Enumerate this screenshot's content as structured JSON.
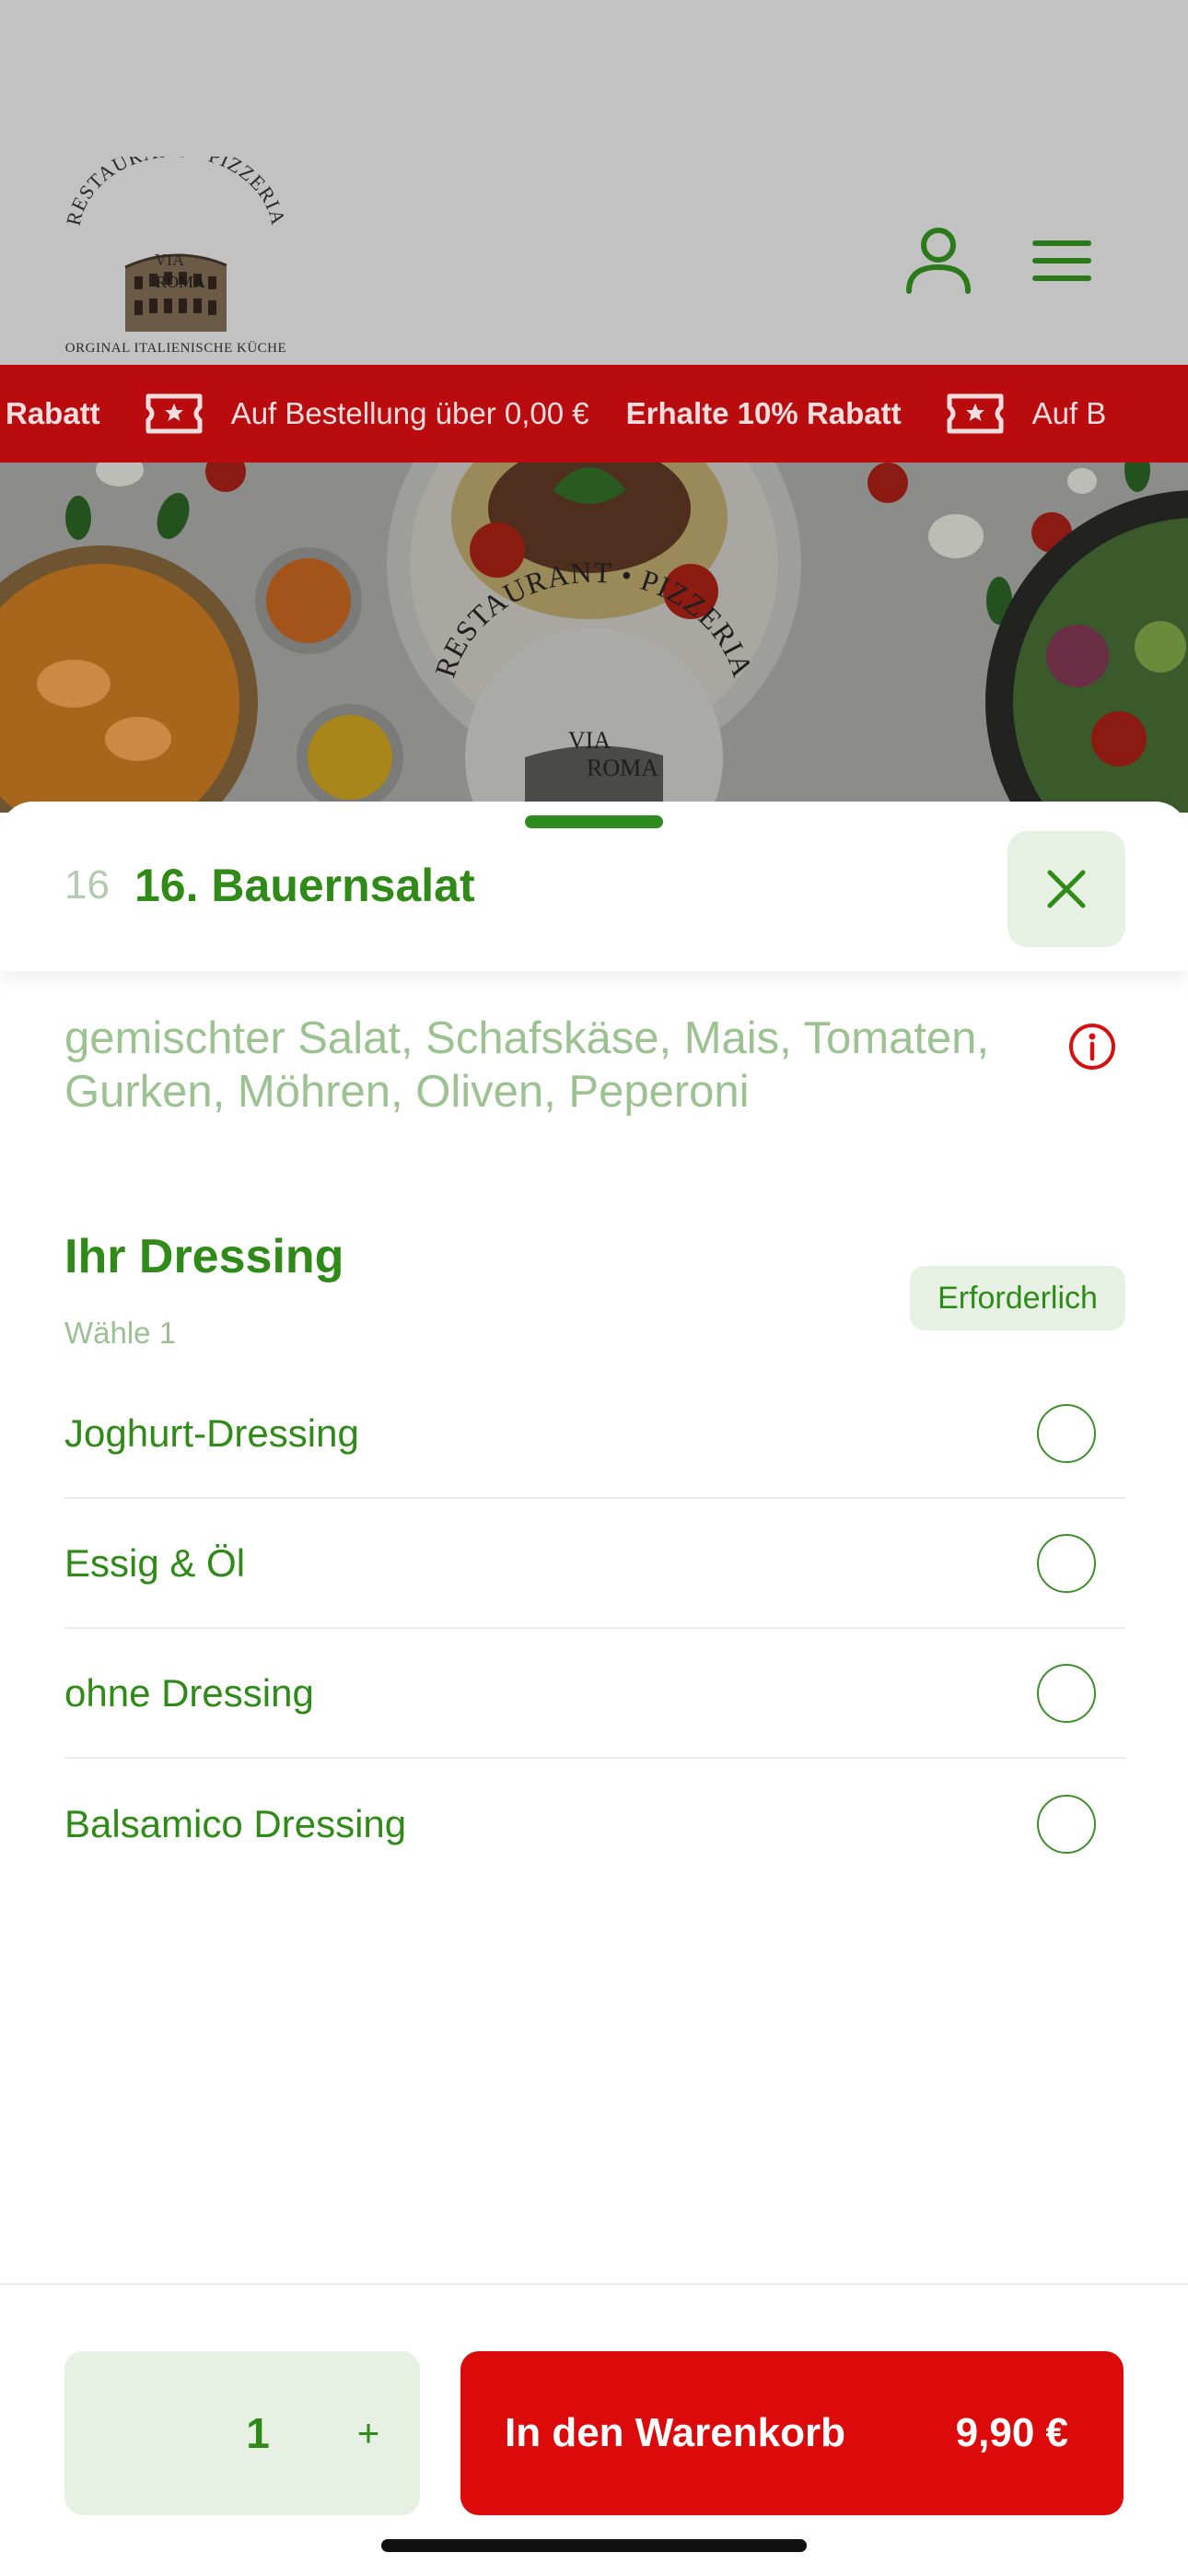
{
  "header": {
    "logo": {
      "arc_text": "RESTAURANT • PIZZERIA",
      "name_line1": "VIA",
      "name_line2": "ROMA",
      "subtitle": "ORGINAL ITALIENISCHE KÜCHE"
    },
    "icons": [
      "user-icon",
      "menu-icon"
    ]
  },
  "ticker": {
    "items": [
      {
        "bold": "Rabatt"
      },
      {
        "icon": "ticket-icon",
        "text": "Auf Bestellung über 0,00 €"
      },
      {
        "bold": "Erhalte 10% Rabatt"
      },
      {
        "icon": "ticket-icon",
        "text": "Auf B"
      }
    ]
  },
  "hero": {
    "arc_text": "RESTAURANT • PIZZERIA",
    "name_line1": "VIA",
    "name_line2": "ROMA"
  },
  "item": {
    "number": "16",
    "title": "16. Bauernsalat",
    "description": "gemischter Salat, Schafskäse, Mais, Tomaten, Gurken, Möhren, Oliven, Peperoni"
  },
  "options_group": {
    "title": "Ihr Dressing",
    "subtitle": "Wähle 1",
    "badge": "Erforderlich",
    "options": [
      {
        "label": "Joghurt-Dressing",
        "selected": false
      },
      {
        "label": "Essig & Öl",
        "selected": false
      },
      {
        "label": "ohne Dressing",
        "selected": false
      },
      {
        "label": "Balsamico Dressing",
        "selected": false
      }
    ]
  },
  "footer": {
    "quantity": "1",
    "plus_label": "+",
    "cart_label": "In den Warenkorb",
    "price": "9,90 €"
  },
  "colors": {
    "brand_green": "#2f8a18",
    "light_green": "#e6f0e3",
    "accent_red": "#dc0a0a",
    "ticker_red": "#ba0b0f"
  }
}
